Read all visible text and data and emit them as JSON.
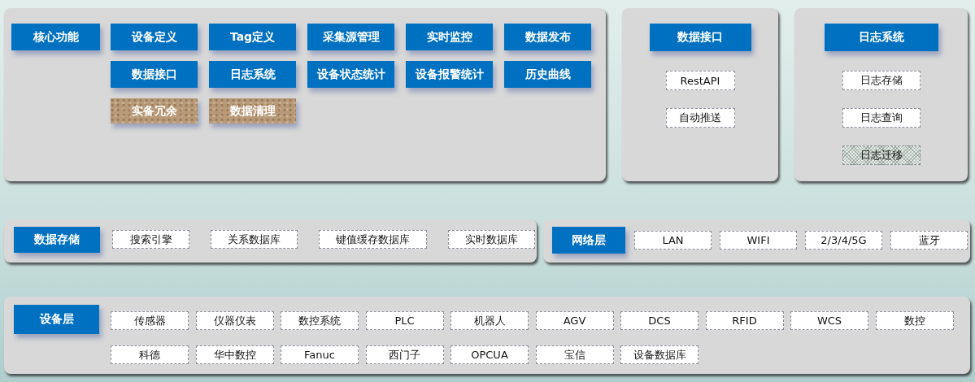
{
  "rows": [
    {
      "panels": [
        {
          "kind": "grid",
          "title": "核心功能",
          "items": [
            {
              "label": "设备定义",
              "kind": "primary"
            },
            {
              "label": "Tag定义",
              "kind": "primary"
            },
            {
              "label": "采集源管理",
              "kind": "primary"
            },
            {
              "label": "实时监控",
              "kind": "primary"
            },
            {
              "label": "数据发布",
              "kind": "primary"
            },
            {
              "label": "数据接口",
              "kind": "primary"
            },
            {
              "label": "日志系统",
              "kind": "primary"
            },
            {
              "label": "设备状态统计",
              "kind": "primary"
            },
            {
              "label": "设备报警统计",
              "kind": "primary"
            },
            {
              "label": "历史曲线",
              "kind": "primary"
            },
            {
              "label": "实备冗余",
              "kind": "textured"
            },
            {
              "label": "数据清理",
              "kind": "textured"
            }
          ]
        },
        {
          "kind": "stack",
          "title": "数据接口",
          "items": [
            {
              "label": "RestAPI",
              "kind": "plain"
            },
            {
              "label": "自动推送",
              "kind": "plain"
            }
          ]
        },
        {
          "kind": "stack-wide",
          "title": "日志系统",
          "items": [
            {
              "label": "日志存储",
              "kind": "plain"
            },
            {
              "label": "日志查询",
              "kind": "plain"
            },
            {
              "label": "日志迁移",
              "kind": "hatched"
            }
          ]
        }
      ]
    },
    {
      "panels": [
        {
          "kind": "inline",
          "title": "数据存储",
          "items": [
            {
              "label": "搜索引擎",
              "kind": "plain"
            },
            {
              "label": "关系数据库",
              "kind": "plain"
            },
            {
              "label": "键值缓存数据库",
              "kind": "plain"
            },
            {
              "label": "实时数据库",
              "kind": "plain"
            }
          ]
        },
        {
          "kind": "inline-tight",
          "title": "网络层",
          "items": [
            {
              "label": "LAN",
              "kind": "plain"
            },
            {
              "label": "WIFI",
              "kind": "plain"
            },
            {
              "label": "2/3/4/5G",
              "kind": "plain"
            },
            {
              "label": "蓝牙",
              "kind": "plain"
            }
          ]
        }
      ]
    },
    {
      "panels": [
        {
          "kind": "wrap",
          "title": "设备层",
          "items": [
            {
              "label": "传感器",
              "kind": "plain"
            },
            {
              "label": "仪器仪表",
              "kind": "plain"
            },
            {
              "label": "数控系统",
              "kind": "plain"
            },
            {
              "label": "PLC",
              "kind": "plain"
            },
            {
              "label": "机器人",
              "kind": "plain"
            },
            {
              "label": "AGV",
              "kind": "plain"
            },
            {
              "label": "DCS",
              "kind": "plain"
            },
            {
              "label": "RFID",
              "kind": "plain"
            },
            {
              "label": "WCS",
              "kind": "plain"
            },
            {
              "label": "数控",
              "kind": "plain"
            },
            {
              "label": "科德",
              "kind": "plain"
            },
            {
              "label": "华中数控",
              "kind": "plain"
            },
            {
              "label": "Fanuc",
              "kind": "plain"
            },
            {
              "label": "西门子",
              "kind": "plain"
            },
            {
              "label": "OPCUA",
              "kind": "plain"
            },
            {
              "label": "宝信",
              "kind": "plain"
            },
            {
              "label": "设备数据库",
              "kind": "plain"
            }
          ]
        }
      ]
    }
  ]
}
